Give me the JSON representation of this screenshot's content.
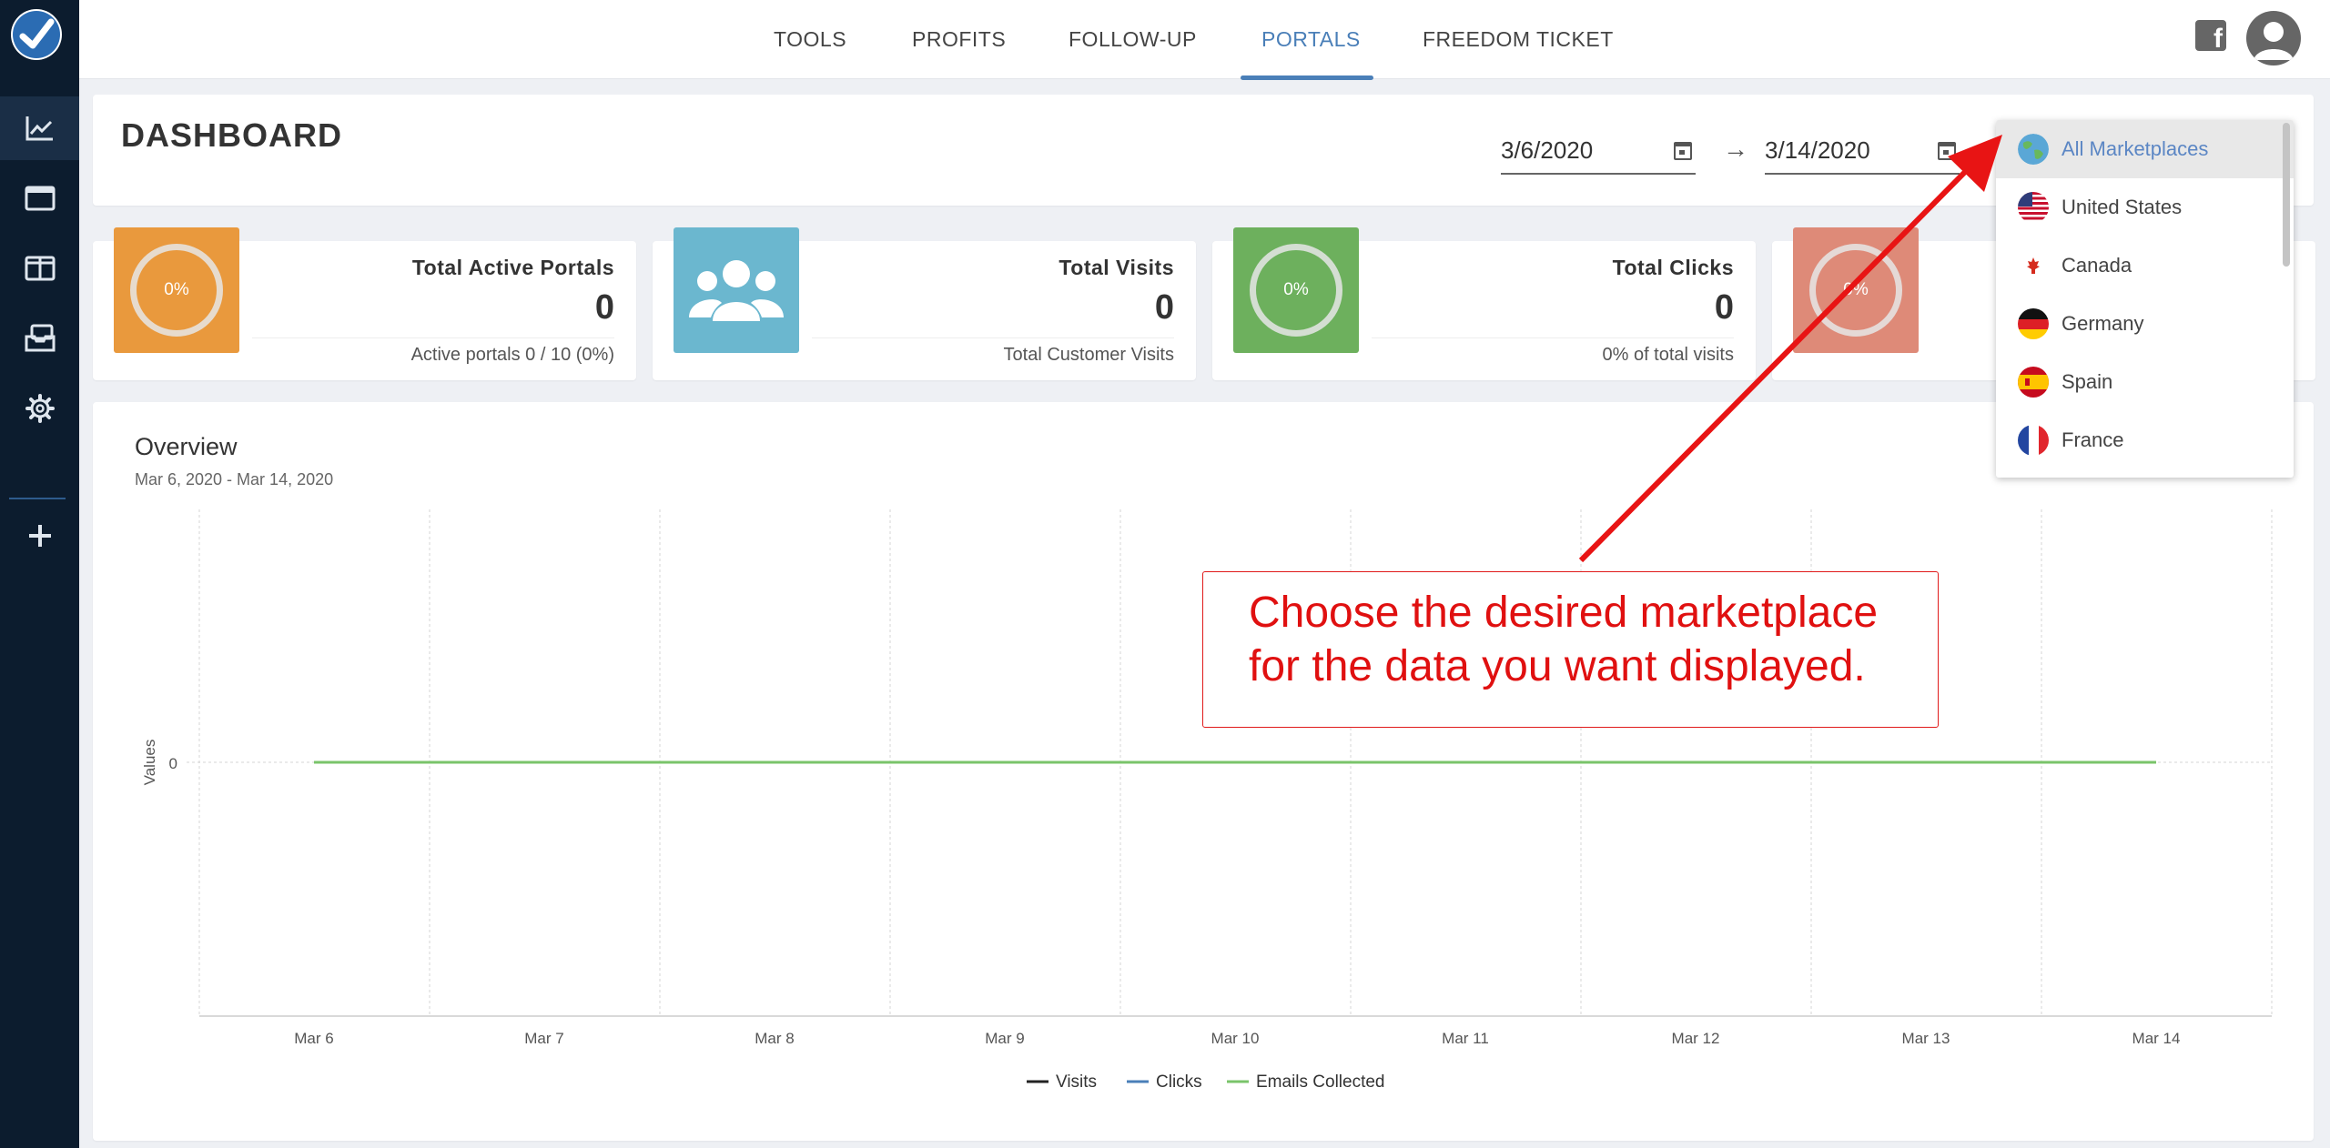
{
  "nav": {
    "tools": "TOOLS",
    "profits": "PROFITS",
    "follow_up": "FOLLOW-UP",
    "portals": "PORTALS",
    "freedom_ticket": "FREEDOM TICKET"
  },
  "header": {
    "title": "DASHBOARD",
    "start_date": "3/6/2020",
    "end_date": "3/14/2020"
  },
  "stats": [
    {
      "title": "Total Active Portals",
      "value": "0",
      "sub": "Active portals 0 / 10 (0%)",
      "ring": "0%",
      "color": "#e9993d"
    },
    {
      "title": "Total Visits",
      "value": "0",
      "sub": "Total Customer Visits",
      "color": "#6bb7cf"
    },
    {
      "title": "Total Clicks",
      "value": "0",
      "sub": "0% of total visits",
      "ring": "0%",
      "color": "#6db05d"
    },
    {
      "ring": "0%",
      "color": "#de8a78"
    }
  ],
  "overview": {
    "title": "Overview",
    "range": "Mar 6, 2020 - Mar 14, 2020"
  },
  "chart_data": {
    "type": "line",
    "categories": [
      "Mar 6",
      "Mar 7",
      "Mar 8",
      "Mar 9",
      "Mar 10",
      "Mar 11",
      "Mar 12",
      "Mar 13",
      "Mar 14"
    ],
    "ylabel": "Values",
    "y_ticks": [
      "0"
    ],
    "series": [
      {
        "name": "Visits",
        "color": "#222222",
        "values": [
          0,
          0,
          0,
          0,
          0,
          0,
          0,
          0,
          0
        ]
      },
      {
        "name": "Clicks",
        "color": "#4a7fb8",
        "values": [
          0,
          0,
          0,
          0,
          0,
          0,
          0,
          0,
          0
        ]
      },
      {
        "name": "Emails Collected",
        "color": "#7ac46a",
        "values": [
          0,
          0,
          0,
          0,
          0,
          0,
          0,
          0,
          0
        ]
      }
    ],
    "grid": true,
    "legend": "bottom-center"
  },
  "marketplaces": {
    "items": [
      "All Marketplaces",
      "United States",
      "Canada",
      "Germany",
      "Spain",
      "France"
    ],
    "selected": "All Marketplaces"
  },
  "annotation": {
    "line1": "Choose the desired marketplace",
    "line2": "for the data you want displayed."
  }
}
